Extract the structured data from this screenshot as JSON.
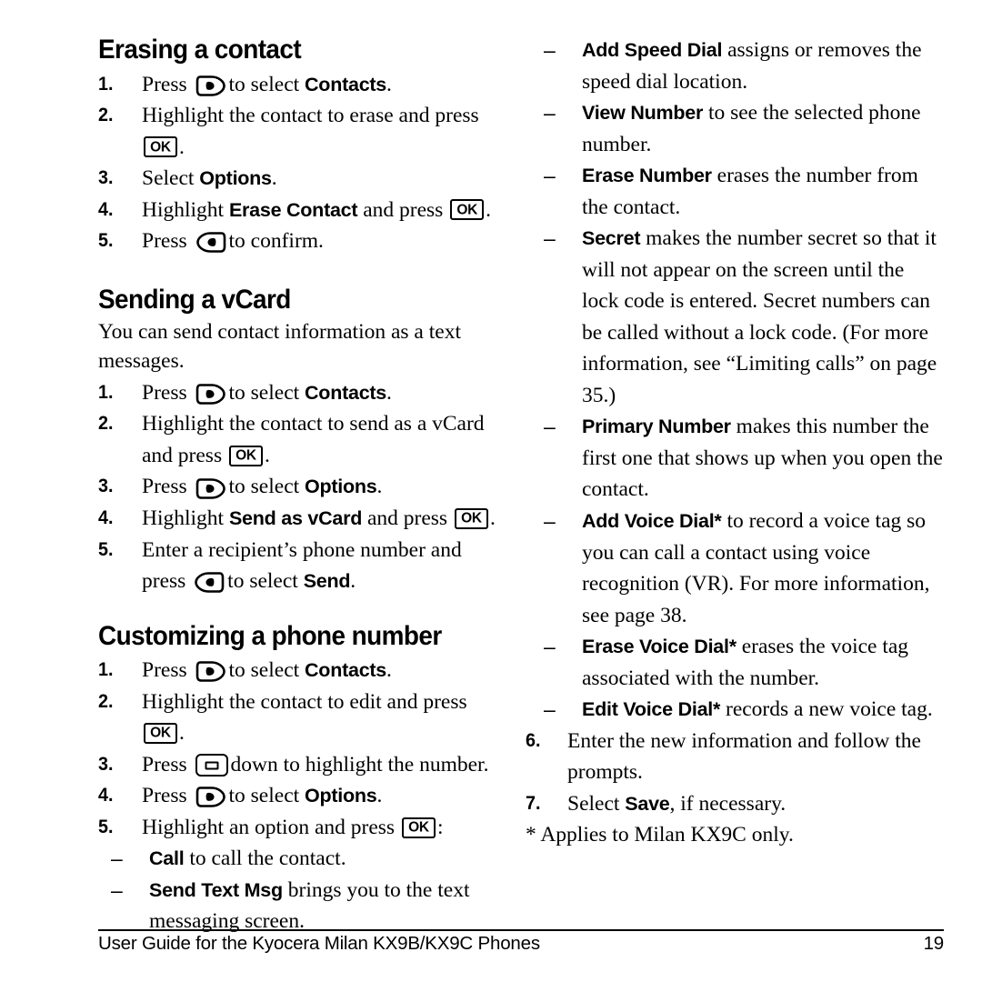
{
  "document": {
    "page_number": "19",
    "footer_text": "User Guide for the Kyocera Milan KX9B/KX9C Phones"
  },
  "left_column": {
    "section1": {
      "heading": "Erasing a contact",
      "steps": [
        {
          "num": "1.",
          "pre": "Press ",
          "key": "soft-right",
          "post": "to select ",
          "ui": "Contacts",
          "tail": "."
        },
        {
          "num": "2.",
          "pre": "Highlight the contact to erase and press ",
          "key": "ok",
          "post": "",
          "ui": "",
          "tail": "."
        },
        {
          "num": "3.",
          "pre": "Select ",
          "key": "",
          "post": "",
          "ui": "Options",
          "tail": "."
        },
        {
          "num": "4.",
          "pre": "Highlight ",
          "key": "ok",
          "post": "",
          "ui": "Erase Contact",
          "tail": " and press "
        },
        {
          "num": "5.",
          "pre": "Press ",
          "key": "soft-left",
          "post": "to confirm.",
          "ui": "",
          "tail": ""
        }
      ]
    },
    "section2": {
      "heading": "Sending a vCard",
      "intro": "You can send contact information as a text messages.",
      "steps": [
        {
          "num": "1.",
          "pre": "Press ",
          "key": "soft-right",
          "post": "to select ",
          "ui": "Contacts",
          "tail": "."
        },
        {
          "num": "2.",
          "pre": "Highlight the contact to send as a vCard and press ",
          "key": "ok",
          "post": "",
          "ui": "",
          "tail": "."
        },
        {
          "num": "3.",
          "pre": "Press ",
          "key": "soft-right",
          "post": "to select ",
          "ui": "Options",
          "tail": "."
        },
        {
          "num": "4.",
          "pre": "Highlight ",
          "key": "ok",
          "post": "",
          "ui": "Send as vCard",
          "tail": " and press "
        },
        {
          "num": "5.",
          "pre": "Enter a recipient’s phone number and press ",
          "key": "soft-left",
          "post": "to select ",
          "ui": "Send",
          "tail": "."
        }
      ]
    },
    "section3": {
      "heading": "Customizing a phone number",
      "steps": [
        {
          "num": "1.",
          "pre": "Press ",
          "key": "soft-right",
          "post": "to select ",
          "ui": "Contacts",
          "tail": "."
        },
        {
          "num": "2.",
          "pre": "Highlight the contact to edit and press ",
          "key": "ok",
          "post": "",
          "ui": "",
          "tail": "."
        },
        {
          "num": "3.",
          "pre": "Press ",
          "key": "nav",
          "post": "down to highlight the number.",
          "ui": "",
          "tail": ""
        },
        {
          "num": "4.",
          "pre": "Press ",
          "key": "soft-right",
          "post": "to select ",
          "ui": "Options",
          "tail": "."
        },
        {
          "num": "5.",
          "pre": "Highlight an option and press ",
          "key": "ok",
          "post": "",
          "ui": "",
          "tail": ":"
        }
      ],
      "subitems": [
        {
          "dash": "–",
          "ui": "Call",
          "text": " to call the contact."
        },
        {
          "dash": "–",
          "ui": "Send Text Msg",
          "text": " brings you to the text messaging screen."
        }
      ]
    }
  },
  "right_column": {
    "subitems": [
      {
        "dash": "–",
        "ui": "Add Speed Dial",
        "text": " assigns or removes the speed dial location."
      },
      {
        "dash": "–",
        "ui": "View Number",
        "text": " to see the selected phone number."
      },
      {
        "dash": "–",
        "ui": "Erase Number",
        "text": " erases the number from the contact."
      },
      {
        "dash": "–",
        "ui": "Secret",
        "text": " makes the number secret so that it will not appear on the screen until the lock code is entered. Secret numbers can be called without a lock code. (For more information, see “Limiting calls” on page 35.)"
      },
      {
        "dash": "–",
        "ui": "Primary Number",
        "text": " makes this number the first one that shows up when you open the contact."
      },
      {
        "dash": "–",
        "ui": "Add Voice Dial*",
        "text": " to record a voice tag so you can call a contact using voice recognition (VR). For more information, see page 38."
      },
      {
        "dash": "–",
        "ui": "Erase Voice Dial*",
        "text": " erases the voice tag associated with the number."
      },
      {
        "dash": "–",
        "ui": "Edit Voice Dial*",
        "text": " records a new voice tag."
      }
    ],
    "steps": [
      {
        "num": "6.",
        "pre": "Enter the new information and follow the prompts.",
        "ui": "",
        "tail": ""
      },
      {
        "num": "7.",
        "pre": "Select ",
        "ui": "Save",
        "tail": ", if necessary."
      }
    ],
    "footnote": "* Applies to Milan KX9C only."
  }
}
